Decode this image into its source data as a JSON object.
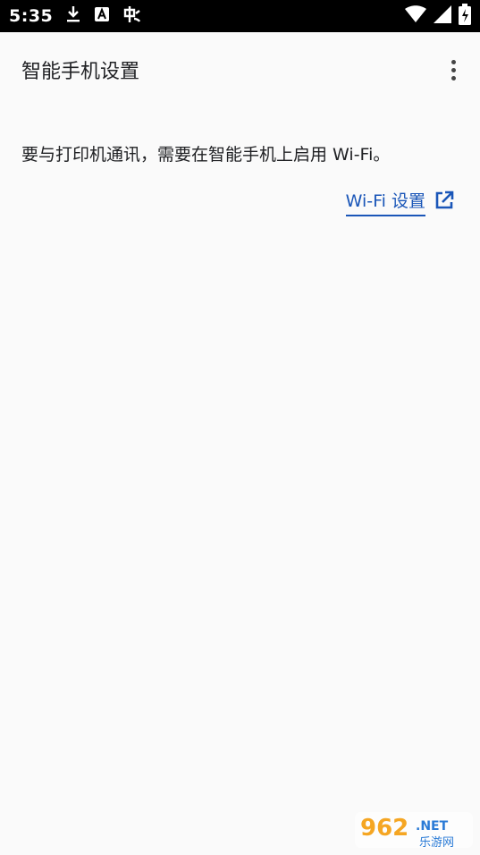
{
  "status_bar": {
    "time": "5:35",
    "icons": [
      "download-icon",
      "text-a-icon",
      "app-notification-icon",
      "wifi-icon",
      "signal-icon",
      "battery-charging-icon"
    ]
  },
  "app_bar": {
    "title": "智能手机设置",
    "menu_icon": "more-vert-icon"
  },
  "main": {
    "message": "要与打印机通讯，需要在智能手机上启用 Wi-Fi。",
    "wifi_link_label": "Wi-Fi 设置",
    "wifi_link_icon": "open-external-icon",
    "link_color": "#1a56b8"
  },
  "watermark": {
    "brand": "962",
    "suffix": ".NET",
    "tagline": "乐游网"
  }
}
